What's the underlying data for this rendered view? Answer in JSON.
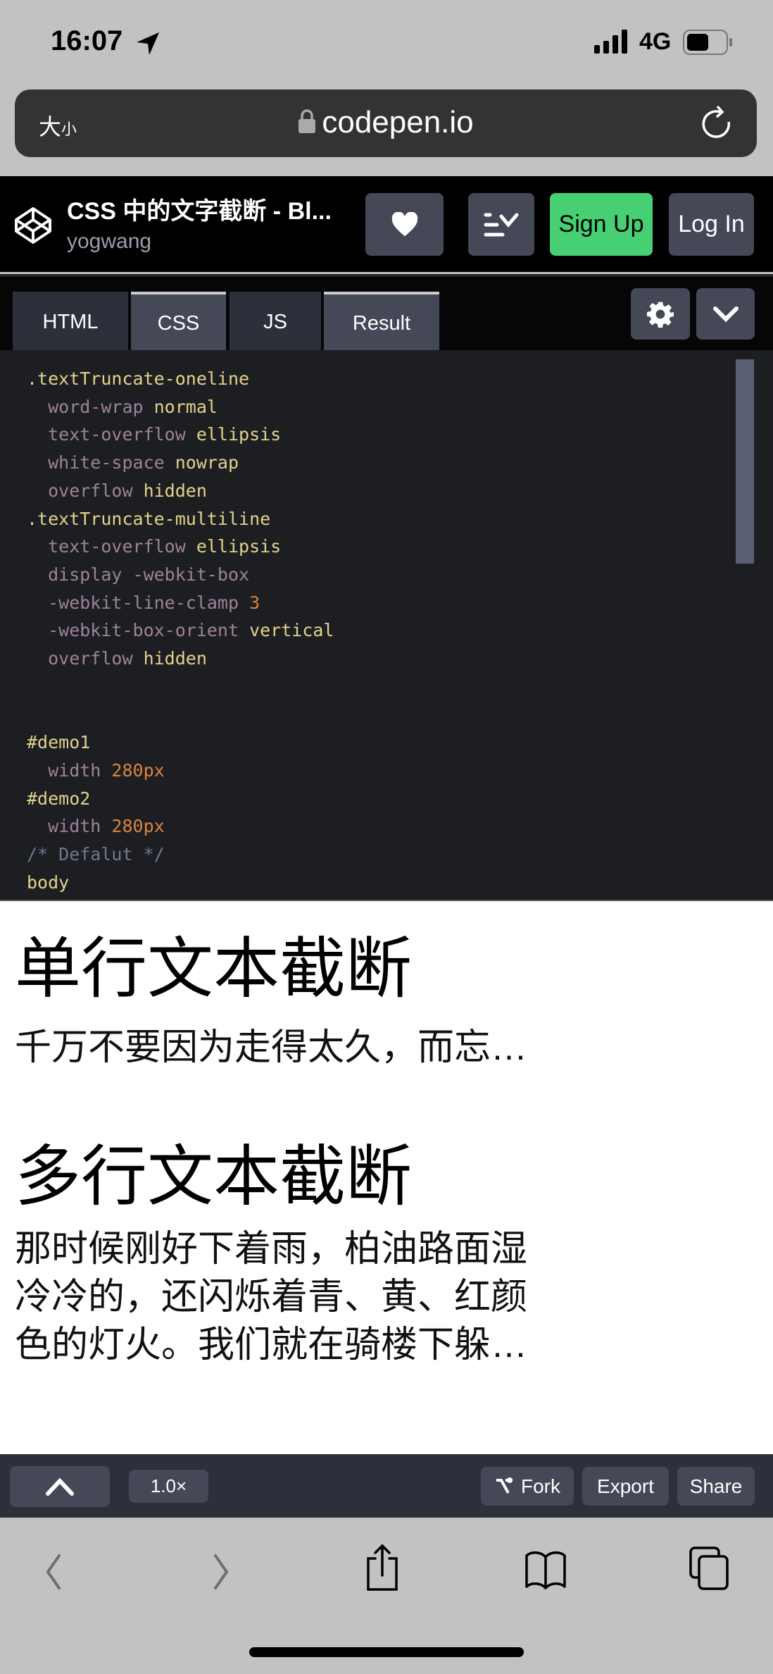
{
  "status_bar": {
    "time": "16:07",
    "network": "4G",
    "icons": [
      "location-arrow-icon",
      "signal-icon",
      "battery-icon"
    ]
  },
  "url_bar": {
    "text_size_big": "大",
    "text_size_small": "小",
    "url": "codepen.io",
    "icons": [
      "lock-icon",
      "reload-icon"
    ]
  },
  "header": {
    "title": "CSS 中的文字截断 - Bl...",
    "author": "yogwang",
    "heart_icon": "heart-icon",
    "signup": "Sign Up",
    "login": "Log In",
    "colors": {
      "signup": "#47cf73"
    }
  },
  "tabs": [
    {
      "label": "HTML"
    },
    {
      "label": "CSS",
      "active": true
    },
    {
      "label": "JS"
    },
    {
      "label": "Result",
      "active": true
    }
  ],
  "code": {
    "lines": [
      [
        {
          "t": ".textTruncate-oneline",
          "c": "sel"
        }
      ],
      [
        {
          "t": "  word-wrap ",
          "c": "prop"
        },
        {
          "t": "normal",
          "c": "val"
        }
      ],
      [
        {
          "t": "  text-overflow ",
          "c": "prop"
        },
        {
          "t": "ellipsis",
          "c": "val"
        }
      ],
      [
        {
          "t": "  white-space ",
          "c": "prop"
        },
        {
          "t": "nowrap",
          "c": "val"
        }
      ],
      [
        {
          "t": "  overflow ",
          "c": "prop"
        },
        {
          "t": "hidden",
          "c": "val"
        }
      ],
      [
        {
          "t": ".textTruncate-multiline",
          "c": "sel"
        }
      ],
      [
        {
          "t": "  text-overflow ",
          "c": "prop"
        },
        {
          "t": "ellipsis",
          "c": "val"
        }
      ],
      [
        {
          "t": "  display -webkit-box",
          "c": "prop"
        }
      ],
      [
        {
          "t": "  -webkit-line-clamp ",
          "c": "prop"
        },
        {
          "t": "3",
          "c": "num"
        }
      ],
      [
        {
          "t": "  -webkit-box-orient ",
          "c": "prop"
        },
        {
          "t": "vertical",
          "c": "val"
        }
      ],
      [
        {
          "t": "  overflow ",
          "c": "prop"
        },
        {
          "t": "hidden",
          "c": "val"
        }
      ],
      [],
      [],
      [
        {
          "t": "#demo1",
          "c": "sel"
        }
      ],
      [
        {
          "t": "  width ",
          "c": "prop"
        },
        {
          "t": "280px",
          "c": "num"
        }
      ],
      [
        {
          "t": "#demo2",
          "c": "sel"
        }
      ],
      [
        {
          "t": "  width ",
          "c": "prop"
        },
        {
          "t": "280px",
          "c": "num"
        }
      ],
      [
        {
          "t": "/* Defalut */",
          "c": "cmt"
        }
      ],
      [
        {
          "t": "body",
          "c": "sel"
        }
      ]
    ]
  },
  "result": {
    "h1": "单行文本截断",
    "oneline": "千万不要因为走得太久，而忘记了我们为什么出发",
    "h2": "多行文本截断",
    "multiline": "那时候刚好下着雨，柏油路面湿冷冷的，还闪烁着青、黄、红颜色的灯火。我们就在骑楼下躲雨，看绿色的邮筒孤独地站在街的对面。"
  },
  "toolbar": {
    "zoom": "1.0×",
    "fork": "Fork",
    "export": "Export",
    "share": "Share"
  },
  "safari_bar": {
    "icons": [
      "back-icon",
      "forward-icon",
      "share-icon",
      "bookmarks-icon",
      "tabs-icon"
    ]
  }
}
